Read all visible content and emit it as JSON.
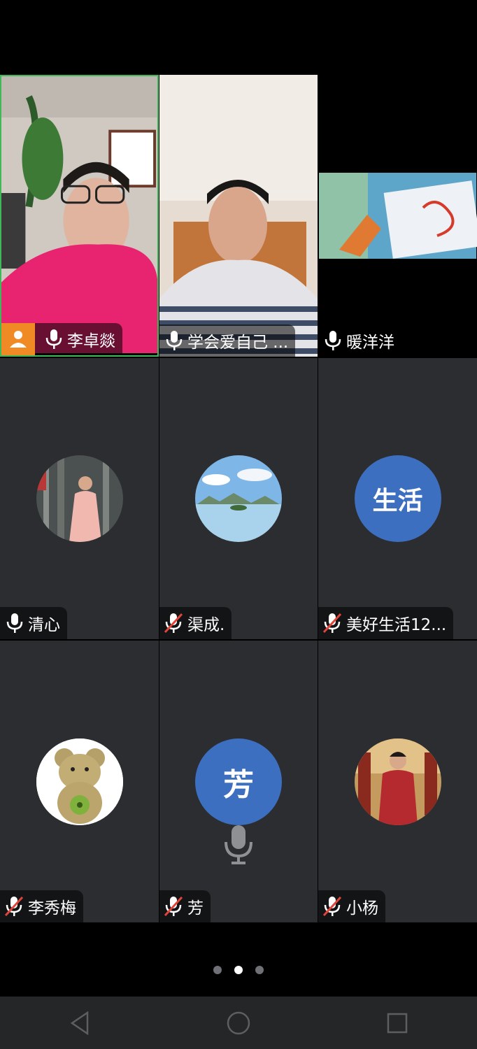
{
  "participants": [
    {
      "name": "李卓燚",
      "muted": false,
      "host": true,
      "video": true,
      "active": true
    },
    {
      "name": "学会爱自己 ...",
      "muted": false,
      "host": false,
      "video": true
    },
    {
      "name": "暖洋洋",
      "muted": false,
      "host": false,
      "video": true
    },
    {
      "name": "清心",
      "muted": false,
      "avatar": "photo-woman-trees-avatar"
    },
    {
      "name": "渠成.",
      "muted": true,
      "avatar": "lake-landscape-avatar"
    },
    {
      "name": "美好生活12...",
      "muted": true,
      "avatar_text": "生活"
    },
    {
      "name": "李秀梅",
      "muted": true,
      "avatar": "teddy-bear-avatar"
    },
    {
      "name": "芳",
      "muted": true,
      "avatar_text": "芳",
      "speaking_indicator": "microphone-icon"
    },
    {
      "name": "小杨",
      "muted": true,
      "avatar": "photo-woman-red-dress-avatar"
    }
  ],
  "pagination": {
    "pages": 3,
    "current": 2
  },
  "colors": {
    "host_badge": "#f08a24",
    "active_border": "#3fb85a",
    "avatar_blue": "#3d6fc0",
    "tile_bg": "#2b2d31"
  },
  "navigation": {
    "back": "back-triangle-icon",
    "home": "home-circle-icon",
    "recents": "recents-square-icon"
  }
}
